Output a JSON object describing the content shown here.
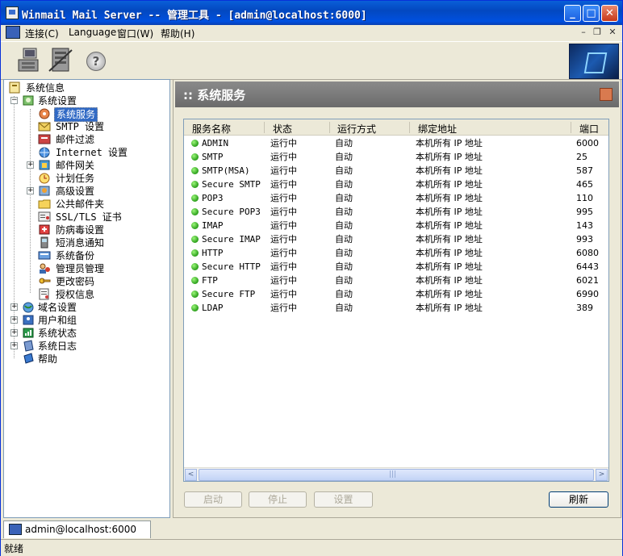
{
  "window": {
    "title": "Winmail Mail Server -- 管理工具 - [admin@localhost:6000]",
    "minimize_glyph": "_",
    "maximize_glyph": "□",
    "close_glyph": "✕"
  },
  "menu": {
    "items": [
      "连接(C)",
      "Language",
      "窗口(W)",
      "帮助(H)"
    ],
    "mdi_minimize": "–",
    "mdi_restore": "❐",
    "mdi_close": "✕"
  },
  "toolbar": {
    "icons": [
      "connect-icon",
      "disconnect-icon",
      "help-icon"
    ],
    "help_glyph": "?"
  },
  "tree": {
    "root": "系统信息",
    "system_settings": "系统设置",
    "children": [
      "系统服务",
      "SMTP 设置",
      "邮件过滤",
      "Internet 设置",
      "邮件网关",
      "计划任务",
      "高级设置",
      "公共邮件夹",
      "SSL/TLS 证书",
      "防病毒设置",
      "短消息通知",
      "系统备份",
      "管理员管理",
      "更改密码",
      "授权信息"
    ],
    "top_level": [
      "域名设置",
      "用户和组",
      "系统状态",
      "系统日志",
      "帮助"
    ],
    "expand_plus": "+",
    "expand_minus": "−"
  },
  "panel": {
    "title": ":: 系统服务"
  },
  "grid": {
    "headers": [
      "服务名称",
      "状态",
      "运行方式",
      "绑定地址",
      "端口"
    ],
    "rows": [
      [
        "ADMIN",
        "运行中",
        "自动",
        "本机所有 IP 地址",
        "6000"
      ],
      [
        "SMTP",
        "运行中",
        "自动",
        "本机所有 IP 地址",
        "25"
      ],
      [
        "SMTP(MSA)",
        "运行中",
        "自动",
        "本机所有 IP 地址",
        "587"
      ],
      [
        "Secure SMTP",
        "运行中",
        "自动",
        "本机所有 IP 地址",
        "465"
      ],
      [
        "POP3",
        "运行中",
        "自动",
        "本机所有 IP 地址",
        "110"
      ],
      [
        "Secure POP3",
        "运行中",
        "自动",
        "本机所有 IP 地址",
        "995"
      ],
      [
        "IMAP",
        "运行中",
        "自动",
        "本机所有 IP 地址",
        "143"
      ],
      [
        "Secure IMAP",
        "运行中",
        "自动",
        "本机所有 IP 地址",
        "993"
      ],
      [
        "HTTP",
        "运行中",
        "自动",
        "本机所有 IP 地址",
        "6080"
      ],
      [
        "Secure HTTP",
        "运行中",
        "自动",
        "本机所有 IP 地址",
        "6443"
      ],
      [
        "FTP",
        "运行中",
        "自动",
        "本机所有 IP 地址",
        "6021"
      ],
      [
        "Secure FTP",
        "运行中",
        "自动",
        "本机所有 IP 地址",
        "6990"
      ],
      [
        "LDAP",
        "运行中",
        "自动",
        "本机所有 IP 地址",
        "389"
      ]
    ],
    "scroll_left": "<",
    "scroll_right": ">",
    "thumb_grip": "|||"
  },
  "buttons": {
    "start": "启动",
    "stop": "停止",
    "settings": "设置",
    "refresh": "刷新"
  },
  "bottom_tab": {
    "label": "admin@localhost:6000"
  },
  "status": {
    "text": "就绪"
  },
  "colors": {
    "accent": "#316AC5",
    "running_dot": "#2a9e1a",
    "title_bar": "#0348C0"
  }
}
